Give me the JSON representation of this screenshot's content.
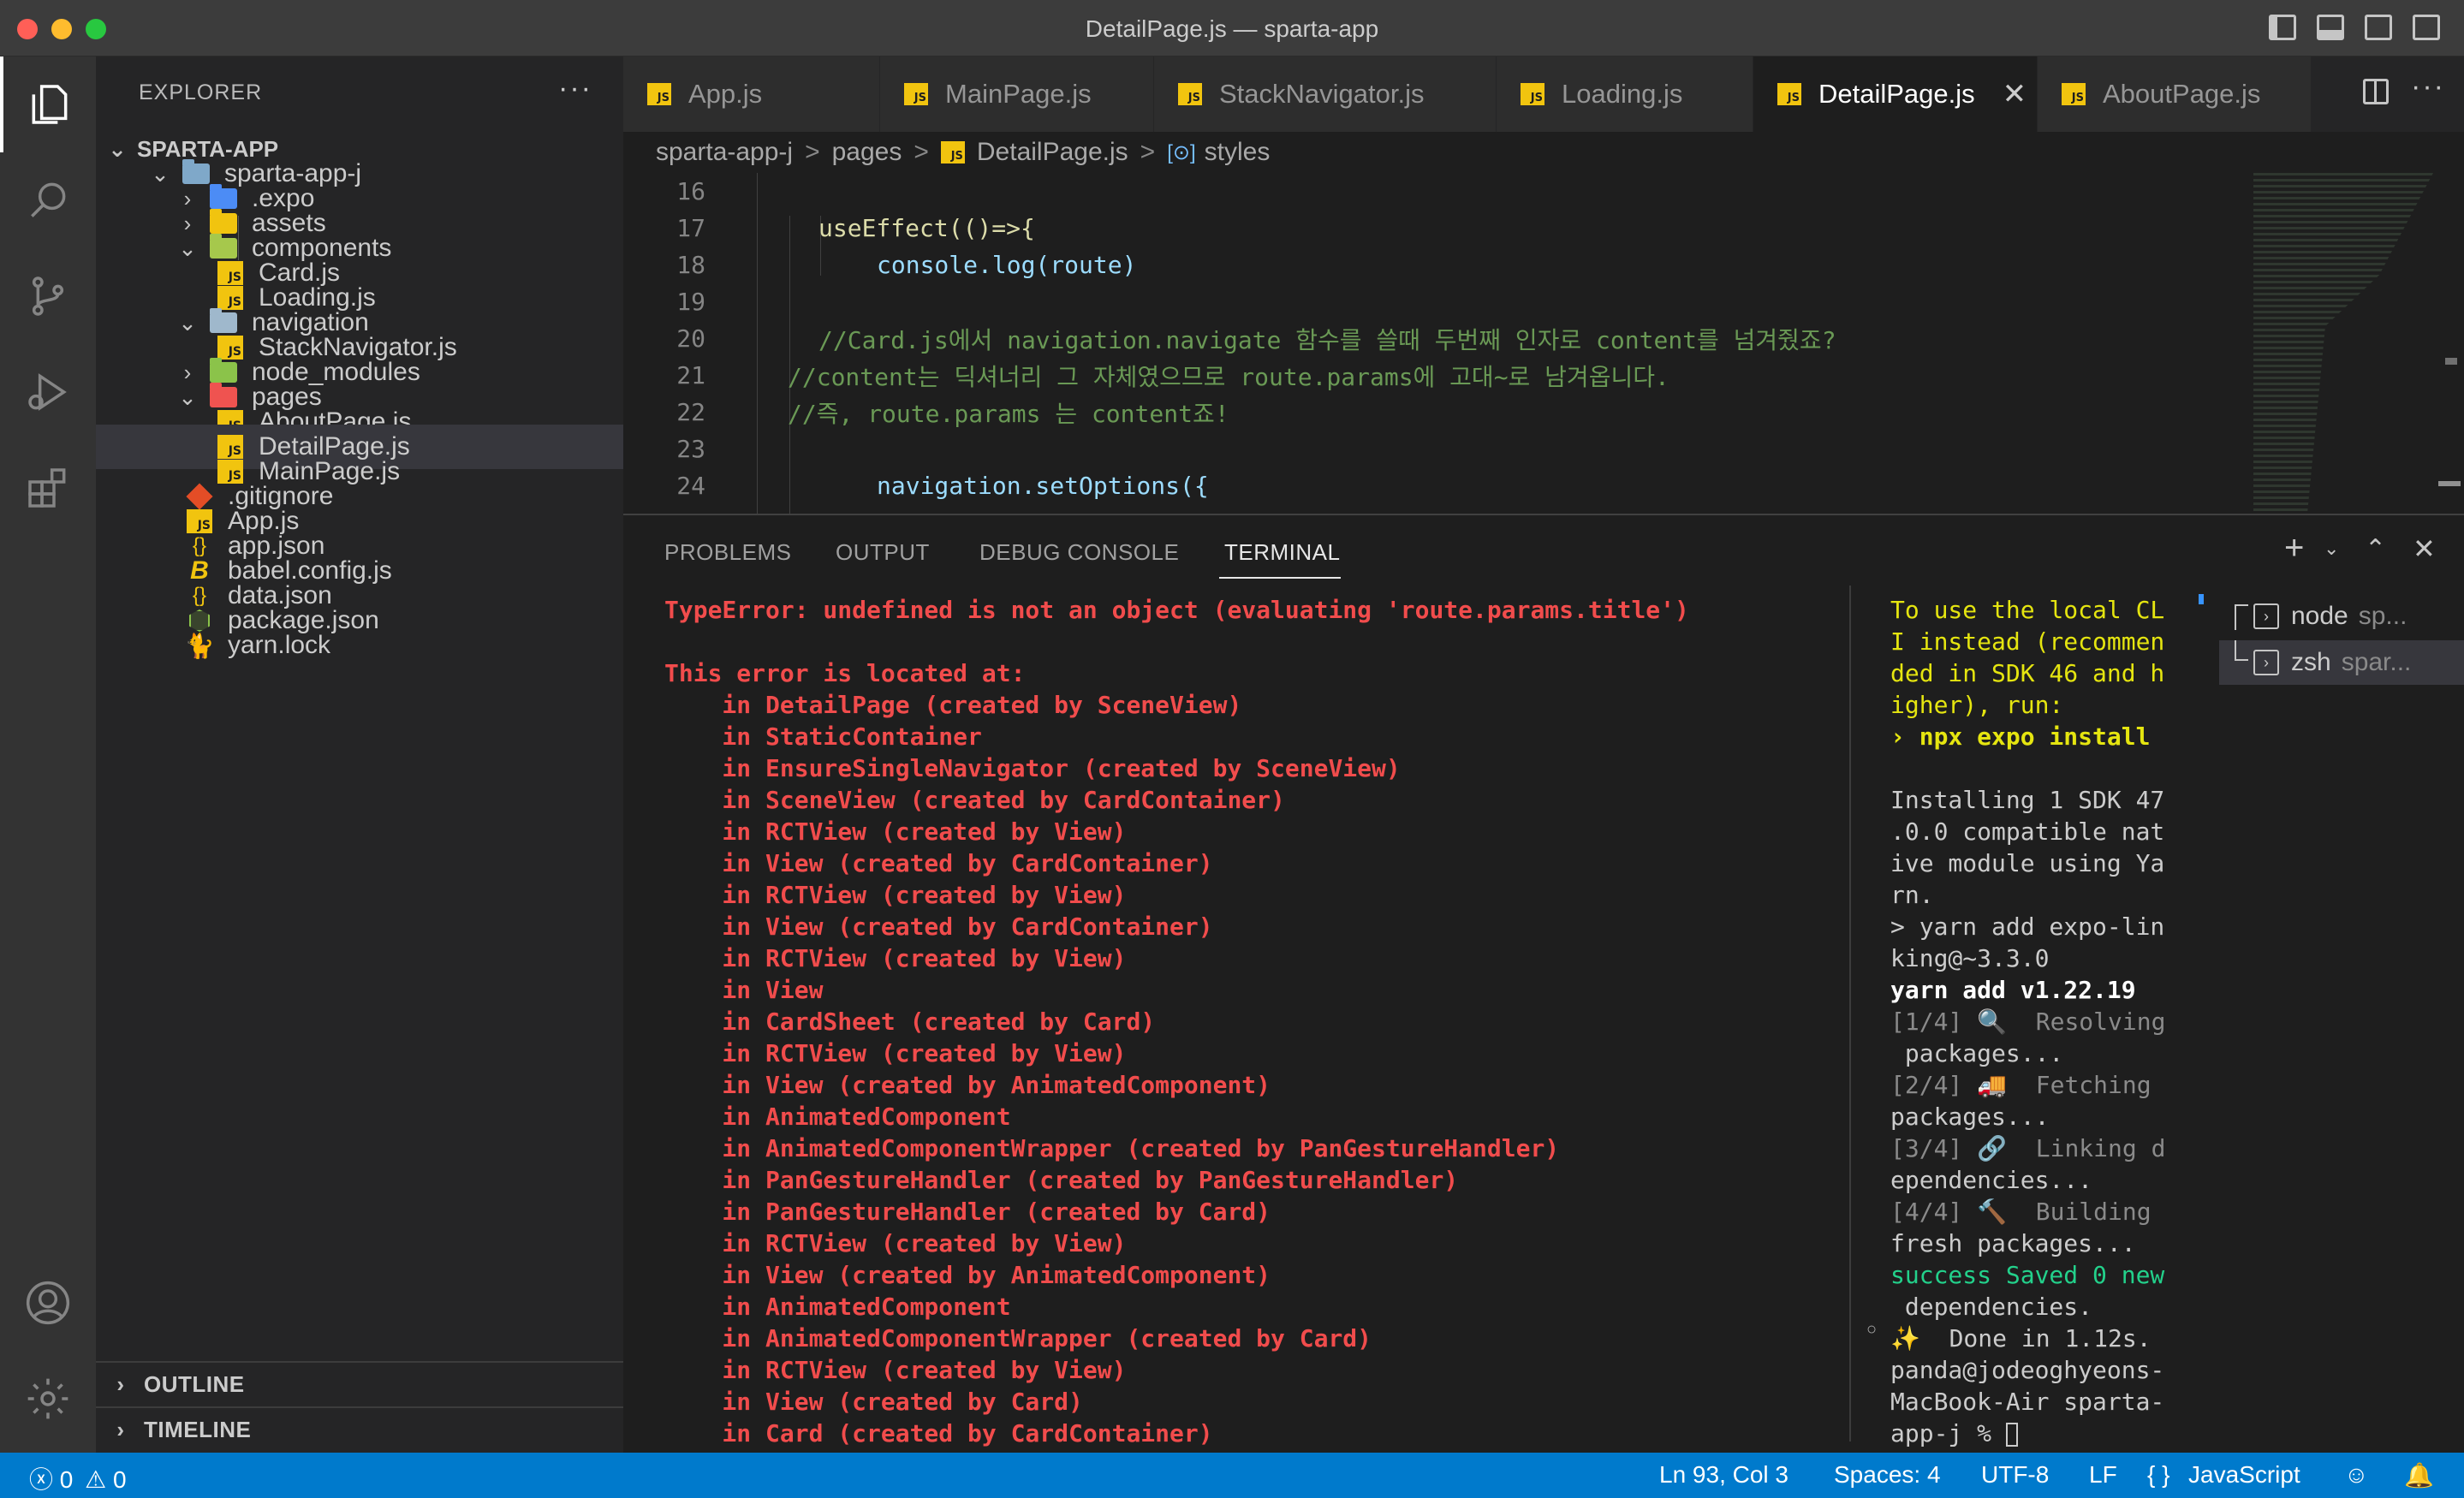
{
  "window": {
    "title": "DetailPage.js — sparta-app"
  },
  "activity": {
    "items": [
      "explorer-icon",
      "search-icon",
      "source-control-icon",
      "run-debug-icon",
      "extensions-icon",
      "account-icon",
      "settings-gear-icon"
    ]
  },
  "sidebar": {
    "title": "EXPLORER",
    "more": "···",
    "root": "SPARTA-APP",
    "tree": {
      "sparta_app_j": "sparta-app-j",
      "expo": ".expo",
      "assets": "assets",
      "components": "components",
      "card": "Card.js",
      "loading": "Loading.js",
      "navigation": "navigation",
      "stacknav": "StackNavigator.js",
      "node_modules": "node_modules",
      "pages": "pages",
      "aboutpage": "AboutPage.js",
      "detailpage": "DetailPage.js",
      "mainpage": "MainPage.js",
      "gitignore": ".gitignore",
      "appjs": "App.js",
      "appjson": "app.json",
      "babel": "babel.config.js",
      "datajson": "data.json",
      "packagejson": "package.json",
      "yarnlock": "yarn.lock"
    },
    "outline": "OUTLINE",
    "timeline": "TIMELINE"
  },
  "tabs": [
    "App.js",
    "MainPage.js",
    "StackNavigator.js",
    "Loading.js",
    "DetailPage.js",
    "AboutPage.js"
  ],
  "tab_js_badge": "JS",
  "breadcrumb": {
    "p1": "sparta-app-j",
    "p2": "pages",
    "p3": "DetailPage.js",
    "p4": "styles",
    "sep": ">"
  },
  "code": {
    "lines": [
      {
        "n": "16",
        "t": ""
      },
      {
        "n": "17",
        "t": "useEffect(()=>{"
      },
      {
        "n": "18",
        "t": "console.log(route)"
      },
      {
        "n": "19",
        "t": ""
      },
      {
        "n": "20",
        "t": "//Card.js에서 navigation.navigate 함수를 쓸때 두번째 인자로 content를 넘겨줬죠?"
      },
      {
        "n": "21",
        "t": "//content는 딕셔너리 그 자체였으므로 route.params에 고대~로 남겨옵니다."
      },
      {
        "n": "22",
        "t": "//즉, route.params 는 content죠!"
      },
      {
        "n": "23",
        "t": ""
      },
      {
        "n": "24",
        "t": "navigation.setOptions({"
      }
    ]
  },
  "panel": {
    "tabs": {
      "problems": "PROBLEMS",
      "output": "OUTPUT",
      "debug": "DEBUG CONSOLE",
      "terminal": "TERMINAL"
    },
    "terminal_left": [
      "TypeError: undefined is not an object (evaluating 'route.params.title')",
      "",
      "This error is located at:",
      "    in DetailPage (created by SceneView)",
      "    in StaticContainer",
      "    in EnsureSingleNavigator (created by SceneView)",
      "    in SceneView (created by CardContainer)",
      "    in RCTView (created by View)",
      "    in View (created by CardContainer)",
      "    in RCTView (created by View)",
      "    in View (created by CardContainer)",
      "    in RCTView (created by View)",
      "    in View",
      "    in CardSheet (created by Card)",
      "    in RCTView (created by View)",
      "    in View (created by AnimatedComponent)",
      "    in AnimatedComponent",
      "    in AnimatedComponentWrapper (created by PanGestureHandler)",
      "    in PanGestureHandler (created by PanGestureHandler)",
      "    in PanGestureHandler (created by Card)",
      "    in RCTView (created by View)",
      "    in View (created by AnimatedComponent)",
      "    in AnimatedComponent",
      "    in AnimatedComponentWrapper (created by Card)",
      "    in RCTView (created by View)",
      "    in View (created by Card)",
      "    in Card (created by CardContainer)"
    ],
    "terminal_right": [
      {
        "t": "To use the local CL",
        "c": "#e5e510"
      },
      {
        "t": "I instead (recommen",
        "c": "#e5e510"
      },
      {
        "t": "ded in SDK 46 and h",
        "c": "#e5e510"
      },
      {
        "t": "igher), run:",
        "c": "#e5e510"
      },
      {
        "t": "› npx expo install",
        "c": "#e5e510",
        "b": true
      },
      {
        "t": "",
        "c": "#cccccc"
      },
      {
        "t": "Installing 1 SDK 47",
        "c": "#cccccc"
      },
      {
        "t": ".0.0 compatible nat",
        "c": "#cccccc"
      },
      {
        "t": "ive module using Ya",
        "c": "#cccccc"
      },
      {
        "t": "rn.",
        "c": "#cccccc"
      },
      {
        "t": "> yarn add expo-lin",
        "c": "#cccccc"
      },
      {
        "t": "king@~3.3.0",
        "c": "#cccccc"
      },
      {
        "t": "yarn add v1.22.19",
        "c": "#ffffff",
        "b": true
      },
      {
        "t": "[1/4] 🔍  Resolving",
        "c": "#8a8a8a"
      },
      {
        "t": " packages...",
        "c": "#cccccc"
      },
      {
        "t": "[2/4] 🚚  Fetching",
        "c": "#8a8a8a"
      },
      {
        "t": "packages...",
        "c": "#cccccc"
      },
      {
        "t": "[3/4] 🔗  Linking d",
        "c": "#8a8a8a"
      },
      {
        "t": "ependencies...",
        "c": "#cccccc"
      },
      {
        "t": "[4/4] 🔨  Building",
        "c": "#8a8a8a"
      },
      {
        "t": "fresh packages...",
        "c": "#cccccc"
      },
      {
        "t": "success Saved 0 new",
        "c": "#23d18b"
      },
      {
        "t": " dependencies.",
        "c": "#cccccc"
      },
      {
        "t": "✨  Done in 1.12s.",
        "c": "#cccccc"
      },
      {
        "t": "panda@jodeoghyeons-",
        "c": "#cccccc"
      },
      {
        "t": "MacBook-Air sparta-",
        "c": "#cccccc"
      },
      {
        "t": "app-j % ",
        "c": "#cccccc"
      }
    ],
    "terminals": [
      {
        "name": "node",
        "sub": "sp..."
      },
      {
        "name": "zsh",
        "sub": "spar..."
      }
    ]
  },
  "status": {
    "errors": "0",
    "warnings": "0",
    "position": "Ln 93, Col 3",
    "spaces": "Spaces: 4",
    "encoding": "UTF-8",
    "eol": "LF",
    "lang_braces": "{ }",
    "language": "JavaScript"
  },
  "colors": {
    "accent": "#007acc",
    "error": "#f14c4c",
    "warning_yellow": "#e5e510",
    "success": "#23d18b",
    "js_icon": "#f1c40f"
  }
}
